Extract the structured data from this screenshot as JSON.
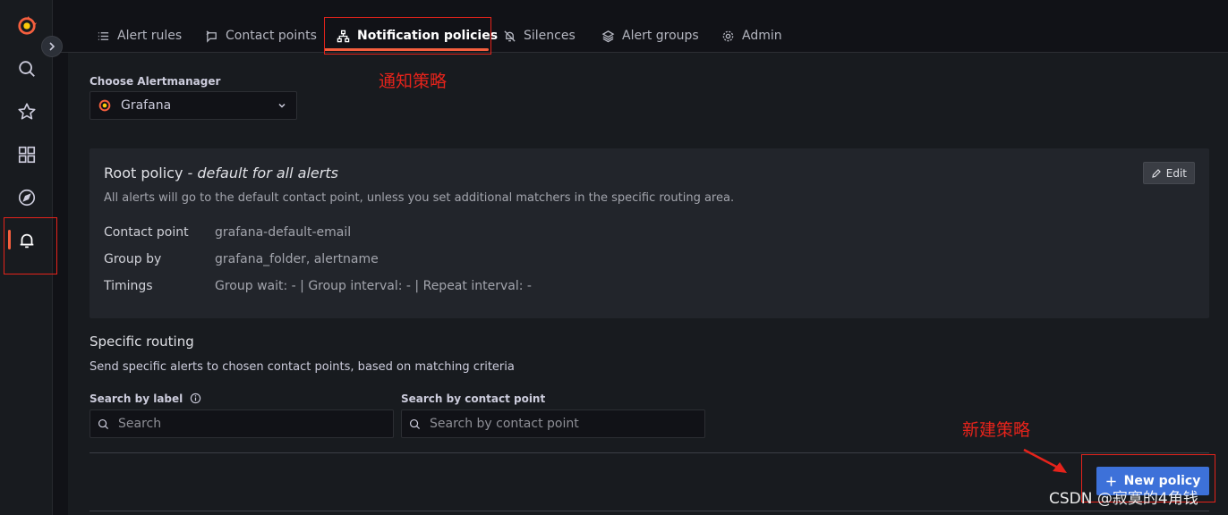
{
  "colors": {
    "brand": "#f55f3e",
    "primary_button": "#3d71d9",
    "annotation": "#e5231b"
  },
  "sidebar": {
    "items": [
      {
        "icon": "grafana-logo-icon"
      },
      {
        "icon": "search-icon"
      },
      {
        "icon": "star-icon"
      },
      {
        "icon": "dashboards-grid-icon"
      },
      {
        "icon": "explore-compass-icon"
      },
      {
        "icon": "alerting-bell-icon",
        "active": true
      }
    ]
  },
  "tabs": [
    {
      "label": "Alert rules",
      "icon": "list-icon"
    },
    {
      "label": "Contact points",
      "icon": "comment-alt-share-icon"
    },
    {
      "label": "Notification policies",
      "icon": "sitemap-icon",
      "active": true
    },
    {
      "label": "Silences",
      "icon": "bell-slash-icon"
    },
    {
      "label": "Alert groups",
      "icon": "layer-group-icon"
    },
    {
      "label": "Admin",
      "icon": "cog-icon"
    }
  ],
  "alertmanager": {
    "label": "Choose Alertmanager",
    "selected": "Grafana"
  },
  "root_policy": {
    "title": "Root policy",
    "title_suffix": "- default for all alerts",
    "description": "All alerts will go to the default contact point, unless you set additional matchers in the specific routing area.",
    "edit_label": "Edit",
    "fields": [
      {
        "label": "Contact point",
        "value": "grafana-default-email"
      },
      {
        "label": "Group by",
        "value": "grafana_folder, alertname"
      },
      {
        "label": "Timings",
        "value": "Group wait: - | Group interval: - | Repeat interval: -"
      }
    ]
  },
  "specific_routing": {
    "title": "Specific routing",
    "description": "Send specific alerts to chosen contact points, based on matching criteria",
    "search_label": {
      "label": "Search by label",
      "placeholder": "Search"
    },
    "search_contact": {
      "label": "Search by contact point",
      "placeholder": "Search by contact point"
    },
    "new_policy_label": "New policy"
  },
  "annotations": {
    "tab_note": "通知策略",
    "button_note": "新建策略"
  },
  "watermark": "CSDN @寂寞的4角钱"
}
